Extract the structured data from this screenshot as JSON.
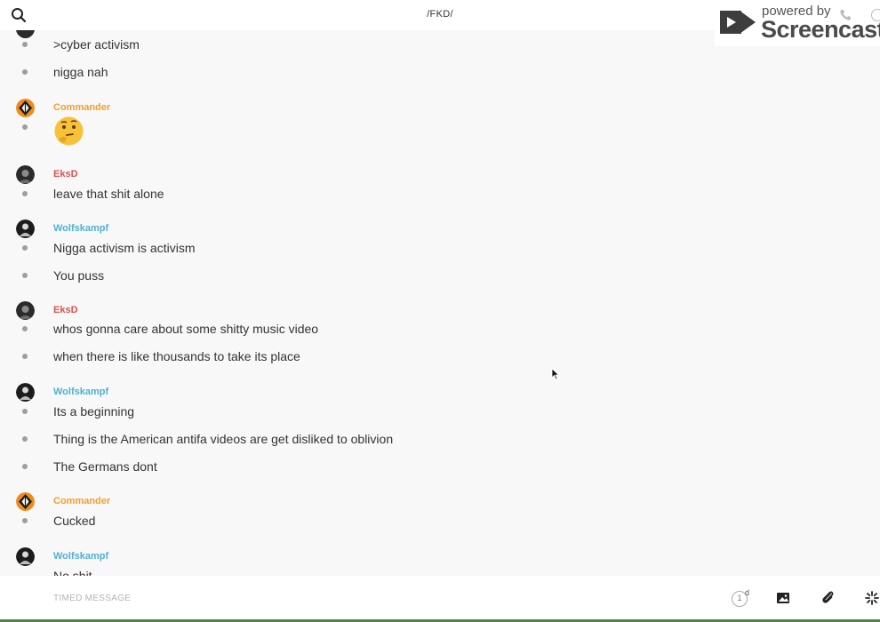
{
  "header": {
    "channel_title": "/FKD/",
    "search_icon": "search-icon"
  },
  "watermark": {
    "small": "powered by",
    "big": "Screencastify"
  },
  "colors": {
    "commander": "#f0a030",
    "eksd": "#d9534f",
    "wolfskampf": "#4fb0d8"
  },
  "messages": {
    "m1": ">cyber activism",
    "m2": "nigga nah",
    "a1": "Commander",
    "e1": "thinking-face-emoji",
    "a2": "EksD",
    "m3": "leave that shit alone",
    "a3": "Wolfskampf",
    "m4": "Nigga activism is activism",
    "m5": "You puss",
    "a4": "EksD",
    "m6": "whos gonna care about some shitty music video",
    "m7": "when there is like thousands to take its place",
    "a5": "Wolfskampf",
    "m8": "Its a beginning",
    "m9": "Thing is the American antifa videos are get disliked to oblivion",
    "m10": "The Germans dont",
    "a6": "Commander",
    "m11": "Cucked",
    "a7": "Wolfskampf",
    "m12": "No shit"
  },
  "composer": {
    "placeholder": "TIMED MESSAGE",
    "timer_value": "1",
    "timer_unit": "d"
  }
}
